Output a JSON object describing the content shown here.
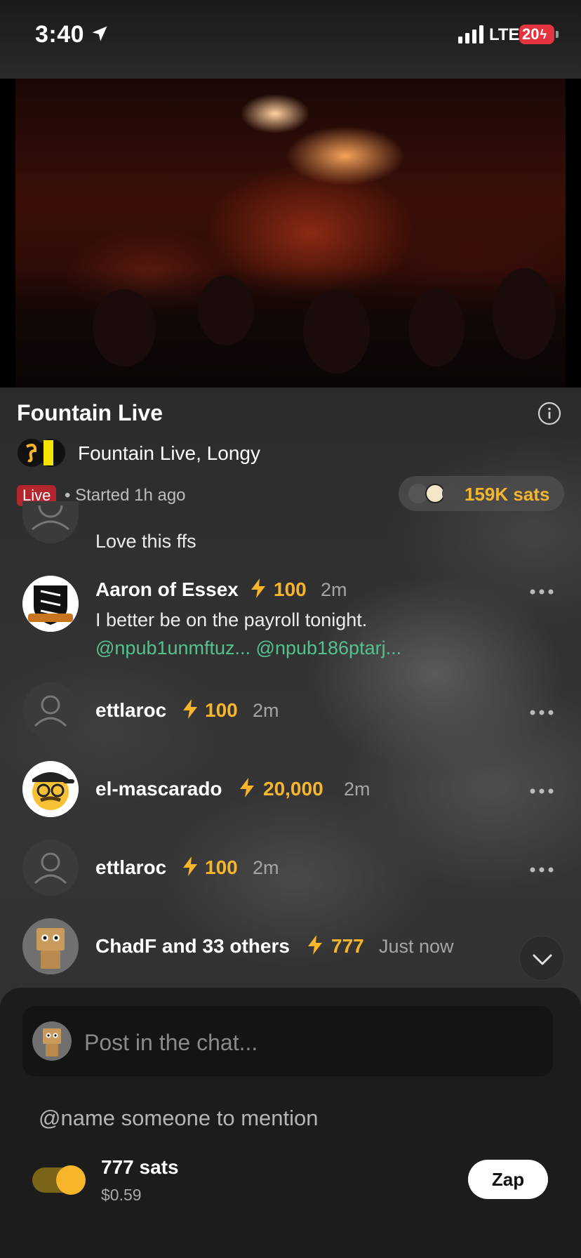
{
  "status_bar": {
    "time": "3:40",
    "network": "LTE",
    "battery": "20"
  },
  "stream": {
    "title": "Fountain Live",
    "channel": "Fountain Live, Longy",
    "live_label": "Live",
    "started": "• Started 1h ago",
    "total_sats": "159K sats"
  },
  "chat": {
    "partial": {
      "text": "Love this ffs"
    },
    "messages": [
      {
        "name": "Aaron of Essex",
        "zap": "100",
        "ago": "2m",
        "text": "I better be on the payroll tonight.",
        "mentions": "@npub1unmftuz... @npub186ptarj..."
      },
      {
        "name": "ettlaroc",
        "zap": "100",
        "ago": "2m"
      },
      {
        "name": "el-mascarado",
        "zap": "20,000",
        "ago": "2m"
      },
      {
        "name": "ettlaroc",
        "zap": "100",
        "ago": "2m"
      },
      {
        "name": "ChadF and 33 others",
        "zap": "777",
        "ago": "Just now"
      }
    ]
  },
  "composer": {
    "placeholder": "Post in the chat...",
    "mention_hint": "@name someone to mention",
    "amount": "777 sats",
    "fiat": "$0.59",
    "zap_label": "Zap",
    "toggle_on": true
  },
  "colors": {
    "accent": "#f7b52c",
    "mention": "#54c28e",
    "live": "#b3262d"
  }
}
